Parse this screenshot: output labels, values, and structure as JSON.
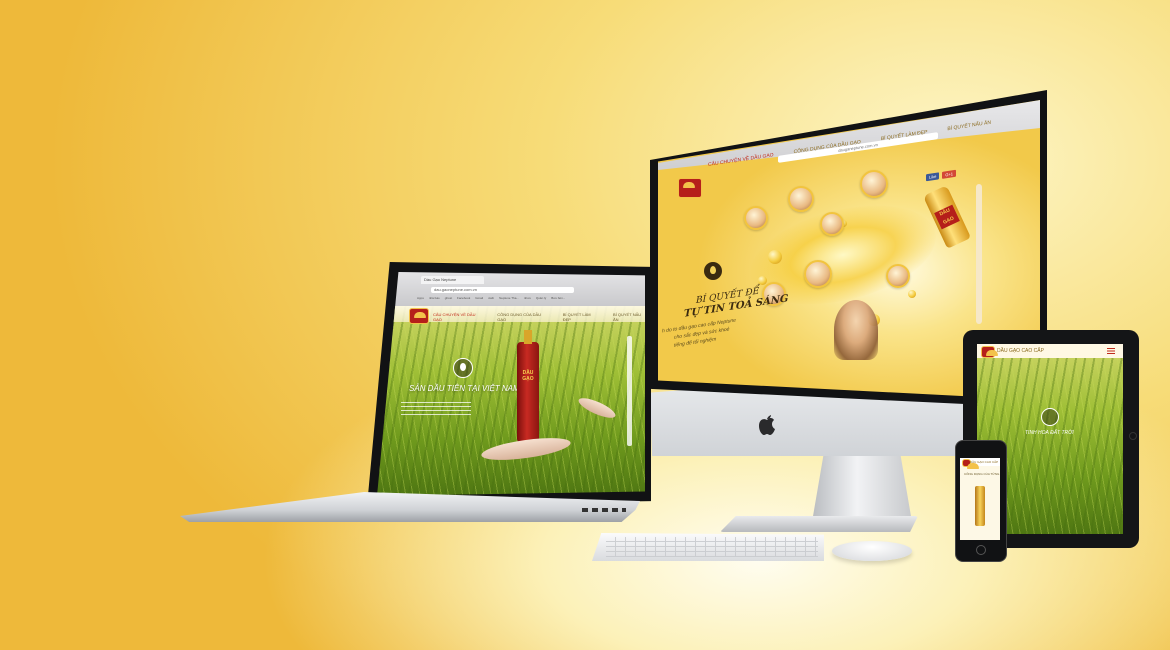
{
  "imac": {
    "url": "dauganeptune.com.vn",
    "nav": [
      "CÂU CHUYỆN VỀ DẦU GẠO",
      "CÔNG DỤNG CỦA DẦU GẠO",
      "BÍ QUYẾT LÀM ĐẸP",
      "BÍ QUYẾT NẤU ĂN"
    ],
    "headline_line1": "BÍ QUYẾT ĐỂ",
    "headline_line2": "TỰ TIN TOẢ SÁNG",
    "body_lines": [
      "h do to dầu gạo cao cấp Neptune",
      "cho sắc đẹp và sức khoẻ",
      "tiếng để tối nghiệm"
    ],
    "bottle_label": "DẦU GẠO",
    "like_label": "Like",
    "plus_label": "G+1"
  },
  "laptop": {
    "tab_title": "Dầu Gạo Neptune",
    "url": "dau.gaoneptune.com.vn",
    "bookmarks": [
      "Apps",
      "nhà báo",
      "ghost",
      "Facebook",
      "Gmail",
      "viwb",
      "Neptune Tha...",
      "nhưu",
      "Quản lý",
      "Bưu bên..."
    ],
    "nav": [
      "CÂU CHUYỆN VỀ DẦU GẠO",
      "CÔNG DỤNG CỦA DẦU GẠO",
      "BÍ QUYẾT LÀM ĐẸP",
      "BÍ QUYẾT NẤU ĂN"
    ],
    "headline": "SẢN DẦU TIÊN TẠI VIỆT NAM",
    "bottle_label": "DẦU GẠO"
  },
  "tablet": {
    "header_title": "DẦU GẠO CAO CẤP",
    "caption": "TINH HOA ĐẤT TRỜI"
  },
  "phone": {
    "header_title": "DẦU GẠO CAO CẤP",
    "text": "CÔNG DỤNG CỦA TỪNG"
  },
  "colors": {
    "brand_red": "#b51f1a",
    "brand_gold": "#f3c24a",
    "grass_green": "#8fb52a"
  }
}
